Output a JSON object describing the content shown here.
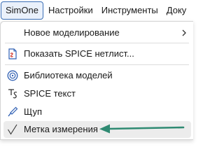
{
  "menubar": {
    "items": [
      {
        "label": "SimOne"
      },
      {
        "label": "Настройки"
      },
      {
        "label": "Инструменты"
      },
      {
        "label": "Доку"
      }
    ]
  },
  "menu": {
    "items": [
      {
        "label": "Новое моделирование",
        "submenu": true
      },
      {
        "label": "Показать SPICE нетлист..."
      },
      {
        "label": "Библиотека моделей"
      },
      {
        "label": "SPICE текст"
      },
      {
        "label": "Щуп"
      },
      {
        "label": "Метка измерения",
        "highlighted": true
      }
    ]
  },
  "colors": {
    "accent_border": "#3b6fb6",
    "annotation_arrow": "#2f8a72",
    "icon_blue": "#2f5fb3",
    "icon_red": "#d23a2f"
  }
}
